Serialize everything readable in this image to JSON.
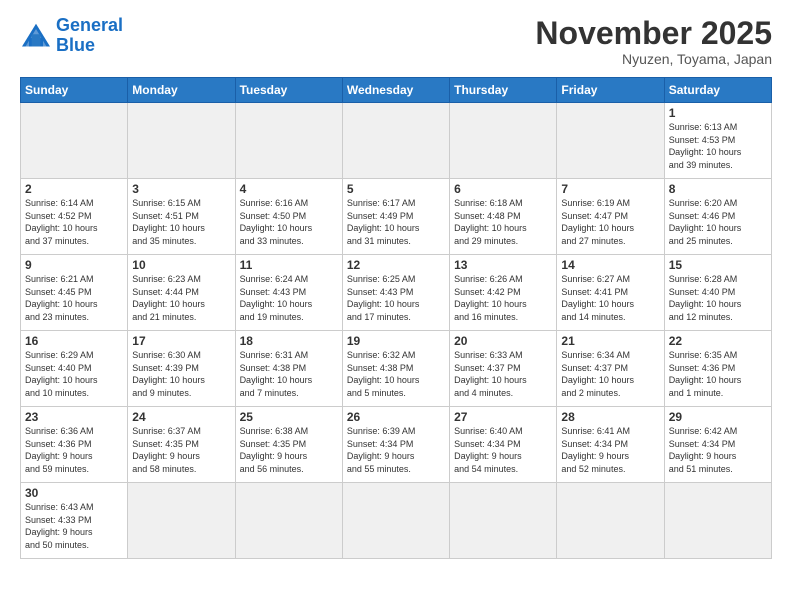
{
  "logo": {
    "text_general": "General",
    "text_blue": "Blue"
  },
  "title": "November 2025",
  "location": "Nyuzen, Toyama, Japan",
  "weekdays": [
    "Sunday",
    "Monday",
    "Tuesday",
    "Wednesday",
    "Thursday",
    "Friday",
    "Saturday"
  ],
  "weeks": [
    [
      {
        "day": "",
        "info": ""
      },
      {
        "day": "",
        "info": ""
      },
      {
        "day": "",
        "info": ""
      },
      {
        "day": "",
        "info": ""
      },
      {
        "day": "",
        "info": ""
      },
      {
        "day": "",
        "info": ""
      },
      {
        "day": "1",
        "info": "Sunrise: 6:13 AM\nSunset: 4:53 PM\nDaylight: 10 hours\nand 39 minutes."
      }
    ],
    [
      {
        "day": "2",
        "info": "Sunrise: 6:14 AM\nSunset: 4:52 PM\nDaylight: 10 hours\nand 37 minutes."
      },
      {
        "day": "3",
        "info": "Sunrise: 6:15 AM\nSunset: 4:51 PM\nDaylight: 10 hours\nand 35 minutes."
      },
      {
        "day": "4",
        "info": "Sunrise: 6:16 AM\nSunset: 4:50 PM\nDaylight: 10 hours\nand 33 minutes."
      },
      {
        "day": "5",
        "info": "Sunrise: 6:17 AM\nSunset: 4:49 PM\nDaylight: 10 hours\nand 31 minutes."
      },
      {
        "day": "6",
        "info": "Sunrise: 6:18 AM\nSunset: 4:48 PM\nDaylight: 10 hours\nand 29 minutes."
      },
      {
        "day": "7",
        "info": "Sunrise: 6:19 AM\nSunset: 4:47 PM\nDaylight: 10 hours\nand 27 minutes."
      },
      {
        "day": "8",
        "info": "Sunrise: 6:20 AM\nSunset: 4:46 PM\nDaylight: 10 hours\nand 25 minutes."
      }
    ],
    [
      {
        "day": "9",
        "info": "Sunrise: 6:21 AM\nSunset: 4:45 PM\nDaylight: 10 hours\nand 23 minutes."
      },
      {
        "day": "10",
        "info": "Sunrise: 6:23 AM\nSunset: 4:44 PM\nDaylight: 10 hours\nand 21 minutes."
      },
      {
        "day": "11",
        "info": "Sunrise: 6:24 AM\nSunset: 4:43 PM\nDaylight: 10 hours\nand 19 minutes."
      },
      {
        "day": "12",
        "info": "Sunrise: 6:25 AM\nSunset: 4:43 PM\nDaylight: 10 hours\nand 17 minutes."
      },
      {
        "day": "13",
        "info": "Sunrise: 6:26 AM\nSunset: 4:42 PM\nDaylight: 10 hours\nand 16 minutes."
      },
      {
        "day": "14",
        "info": "Sunrise: 6:27 AM\nSunset: 4:41 PM\nDaylight: 10 hours\nand 14 minutes."
      },
      {
        "day": "15",
        "info": "Sunrise: 6:28 AM\nSunset: 4:40 PM\nDaylight: 10 hours\nand 12 minutes."
      }
    ],
    [
      {
        "day": "16",
        "info": "Sunrise: 6:29 AM\nSunset: 4:40 PM\nDaylight: 10 hours\nand 10 minutes."
      },
      {
        "day": "17",
        "info": "Sunrise: 6:30 AM\nSunset: 4:39 PM\nDaylight: 10 hours\nand 9 minutes."
      },
      {
        "day": "18",
        "info": "Sunrise: 6:31 AM\nSunset: 4:38 PM\nDaylight: 10 hours\nand 7 minutes."
      },
      {
        "day": "19",
        "info": "Sunrise: 6:32 AM\nSunset: 4:38 PM\nDaylight: 10 hours\nand 5 minutes."
      },
      {
        "day": "20",
        "info": "Sunrise: 6:33 AM\nSunset: 4:37 PM\nDaylight: 10 hours\nand 4 minutes."
      },
      {
        "day": "21",
        "info": "Sunrise: 6:34 AM\nSunset: 4:37 PM\nDaylight: 10 hours\nand 2 minutes."
      },
      {
        "day": "22",
        "info": "Sunrise: 6:35 AM\nSunset: 4:36 PM\nDaylight: 10 hours\nand 1 minute."
      }
    ],
    [
      {
        "day": "23",
        "info": "Sunrise: 6:36 AM\nSunset: 4:36 PM\nDaylight: 9 hours\nand 59 minutes."
      },
      {
        "day": "24",
        "info": "Sunrise: 6:37 AM\nSunset: 4:35 PM\nDaylight: 9 hours\nand 58 minutes."
      },
      {
        "day": "25",
        "info": "Sunrise: 6:38 AM\nSunset: 4:35 PM\nDaylight: 9 hours\nand 56 minutes."
      },
      {
        "day": "26",
        "info": "Sunrise: 6:39 AM\nSunset: 4:34 PM\nDaylight: 9 hours\nand 55 minutes."
      },
      {
        "day": "27",
        "info": "Sunrise: 6:40 AM\nSunset: 4:34 PM\nDaylight: 9 hours\nand 54 minutes."
      },
      {
        "day": "28",
        "info": "Sunrise: 6:41 AM\nSunset: 4:34 PM\nDaylight: 9 hours\nand 52 minutes."
      },
      {
        "day": "29",
        "info": "Sunrise: 6:42 AM\nSunset: 4:34 PM\nDaylight: 9 hours\nand 51 minutes."
      }
    ],
    [
      {
        "day": "30",
        "info": "Sunrise: 6:43 AM\nSunset: 4:33 PM\nDaylight: 9 hours\nand 50 minutes."
      },
      {
        "day": "",
        "info": ""
      },
      {
        "day": "",
        "info": ""
      },
      {
        "day": "",
        "info": ""
      },
      {
        "day": "",
        "info": ""
      },
      {
        "day": "",
        "info": ""
      },
      {
        "day": "",
        "info": ""
      }
    ]
  ]
}
